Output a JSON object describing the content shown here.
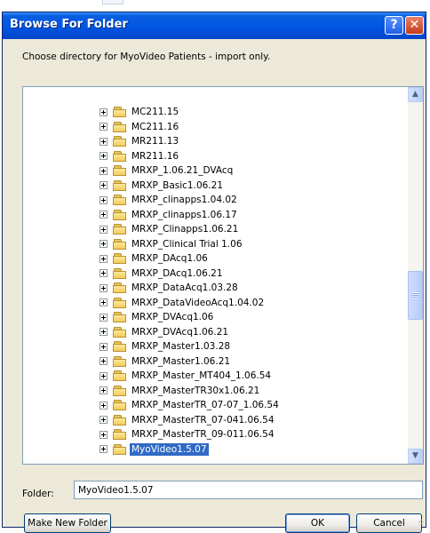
{
  "window": {
    "title": "Browse For Folder",
    "help_button": "?",
    "close_button": "✕"
  },
  "instruction": "Choose directory for MyoVideo Patients - import only.",
  "tree": {
    "items": [
      {
        "label": "MC211.15",
        "selected": false
      },
      {
        "label": "MC211.16",
        "selected": false
      },
      {
        "label": "MR211.13",
        "selected": false
      },
      {
        "label": "MR211.16",
        "selected": false
      },
      {
        "label": "MRXP_1.06.21_DVAcq",
        "selected": false
      },
      {
        "label": "MRXP_Basic1.06.21",
        "selected": false
      },
      {
        "label": "MRXP_clinapps1.04.02",
        "selected": false
      },
      {
        "label": "MRXP_clinapps1.06.17",
        "selected": false
      },
      {
        "label": "MRXP_Clinapps1.06.21",
        "selected": false
      },
      {
        "label": "MRXP_Clinical Trial 1.06",
        "selected": false
      },
      {
        "label": "MRXP_DAcq1.06",
        "selected": false
      },
      {
        "label": "MRXP_DAcq1.06.21",
        "selected": false
      },
      {
        "label": "MRXP_DataAcq1.03.28",
        "selected": false
      },
      {
        "label": "MRXP_DataVideoAcq1.04.02",
        "selected": false
      },
      {
        "label": "MRXP_DVAcq1.06",
        "selected": false
      },
      {
        "label": "MRXP_DVAcq1.06.21",
        "selected": false
      },
      {
        "label": "MRXP_Master1.03.28",
        "selected": false
      },
      {
        "label": "MRXP_Master1.06.21",
        "selected": false
      },
      {
        "label": "MRXP_Master_MT404_1.06.54",
        "selected": false
      },
      {
        "label": "MRXP_MasterTR30x1.06.21",
        "selected": false
      },
      {
        "label": "MRXP_MasterTR_07-07_1.06.54",
        "selected": false
      },
      {
        "label": "MRXP_MasterTR_07-041.06.54",
        "selected": false
      },
      {
        "label": "MRXP_MasterTR_09-011.06.54",
        "selected": false
      },
      {
        "label": "MyoVideo1.5.07",
        "selected": true
      }
    ],
    "scroll_up_icon": "▲",
    "scroll_down_icon": "▼"
  },
  "folder_field": {
    "label": "Folder:",
    "value": "MyoVideo1.5.07"
  },
  "buttons": {
    "make_new_folder": "Make New Folder",
    "ok": "OK",
    "cancel": "Cancel"
  },
  "colors": {
    "titlebar": "#0055e5",
    "selection": "#316ac5",
    "dialog_bg": "#ece9d8"
  }
}
